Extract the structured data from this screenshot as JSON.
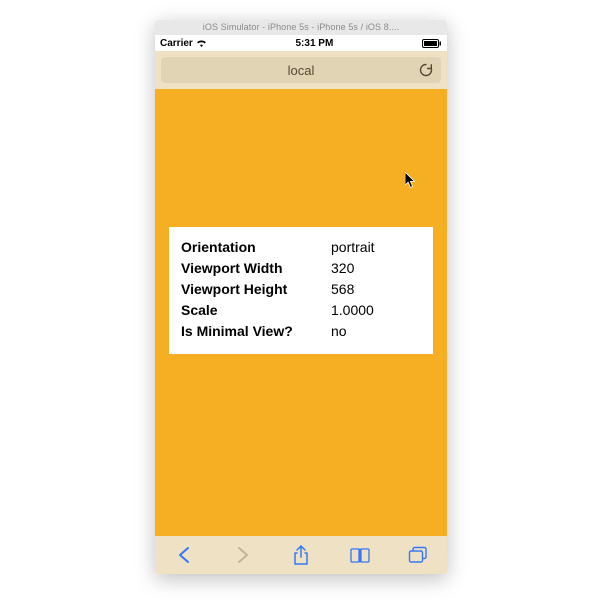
{
  "window": {
    "title": "iOS Simulator - iPhone 5s - iPhone 5s / iOS 8...."
  },
  "status_bar": {
    "carrier": "Carrier",
    "time": "5:31 PM"
  },
  "nav": {
    "url": "local"
  },
  "info": {
    "labels": {
      "orientation": "Orientation",
      "viewport_width": "Viewport Width",
      "viewport_height": "Viewport Height",
      "scale": "Scale",
      "is_minimal": "Is Minimal View?"
    },
    "values": {
      "orientation": "portrait",
      "viewport_width": "320",
      "viewport_height": "568",
      "scale": "1.0000",
      "is_minimal": "no"
    }
  }
}
